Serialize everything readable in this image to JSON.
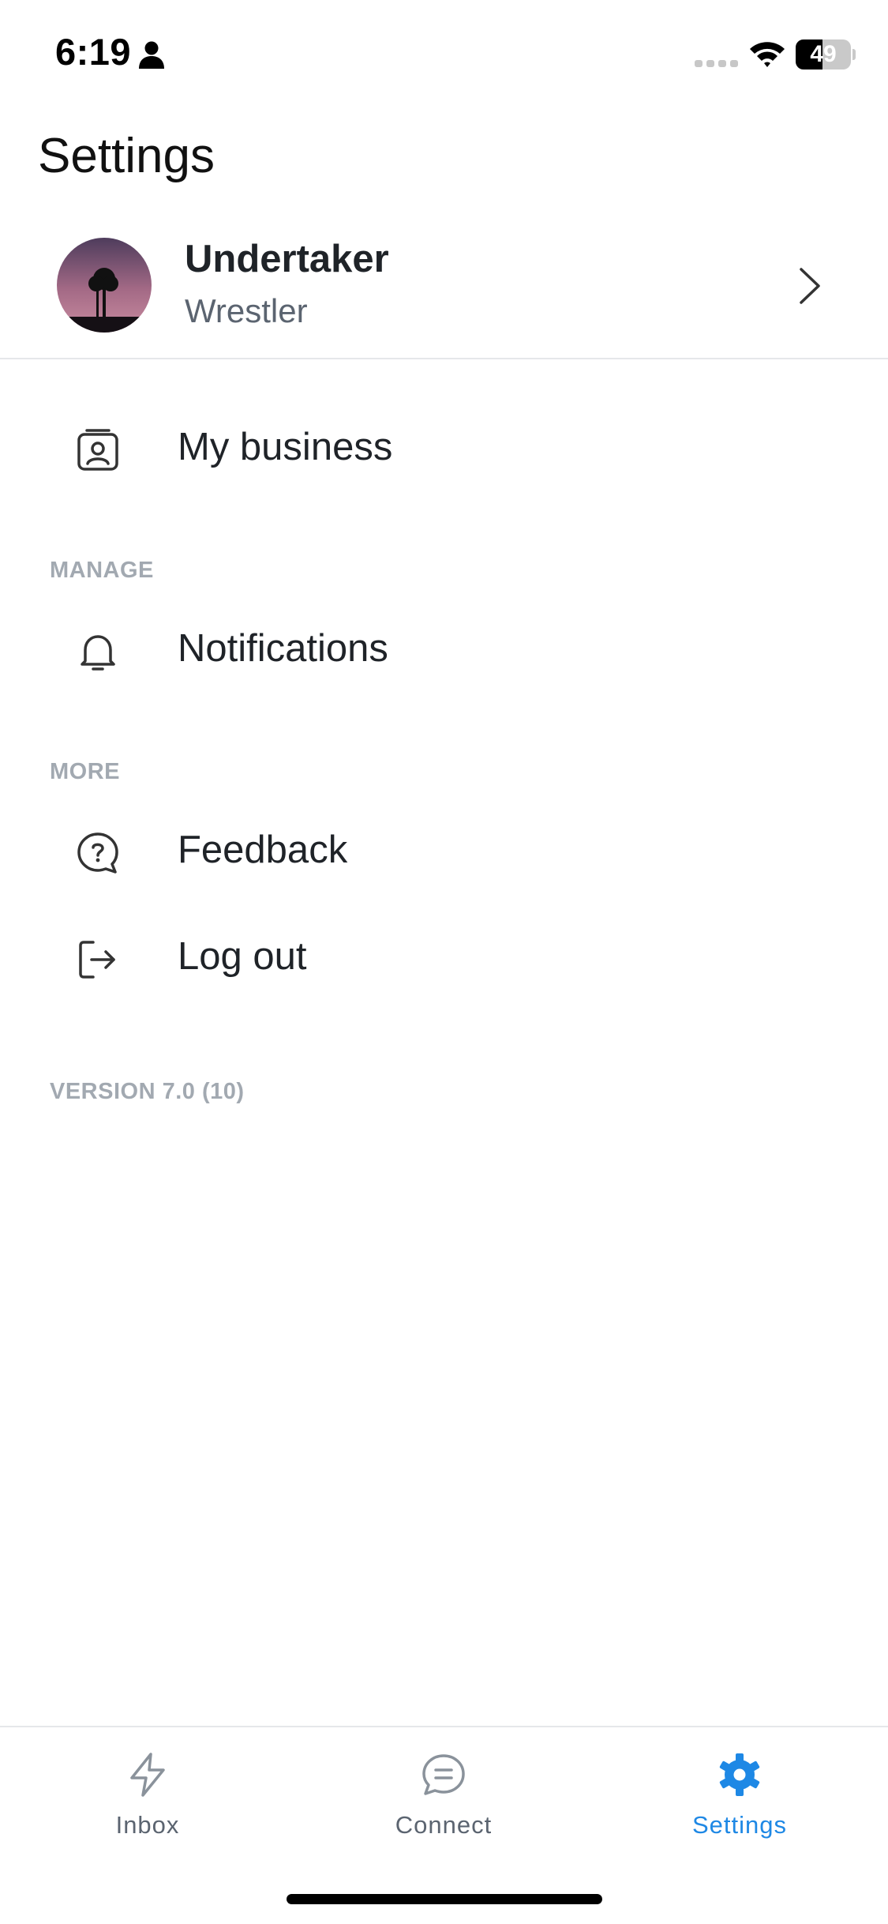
{
  "status_bar": {
    "time": "6:19",
    "battery": "49",
    "battery_level": 0.49
  },
  "header": {
    "title": "Settings"
  },
  "profile": {
    "name": "Undertaker",
    "role": "Wrestler"
  },
  "menu": {
    "my_business": "My business",
    "manage_header": "MANAGE",
    "notifications": "Notifications",
    "more_header": "MORE",
    "feedback": "Feedback",
    "logout": "Log out"
  },
  "version": "VERSION 7.0 (10)",
  "tabs": [
    {
      "label": "Inbox",
      "icon": "lightning-icon",
      "active": false
    },
    {
      "label": "Connect",
      "icon": "chat-icon",
      "active": false
    },
    {
      "label": "Settings",
      "icon": "gear-icon",
      "active": true
    }
  ],
  "colors": {
    "accent": "#1e88e5",
    "inactive": "#5b6470",
    "section": "#a2a9b1"
  }
}
